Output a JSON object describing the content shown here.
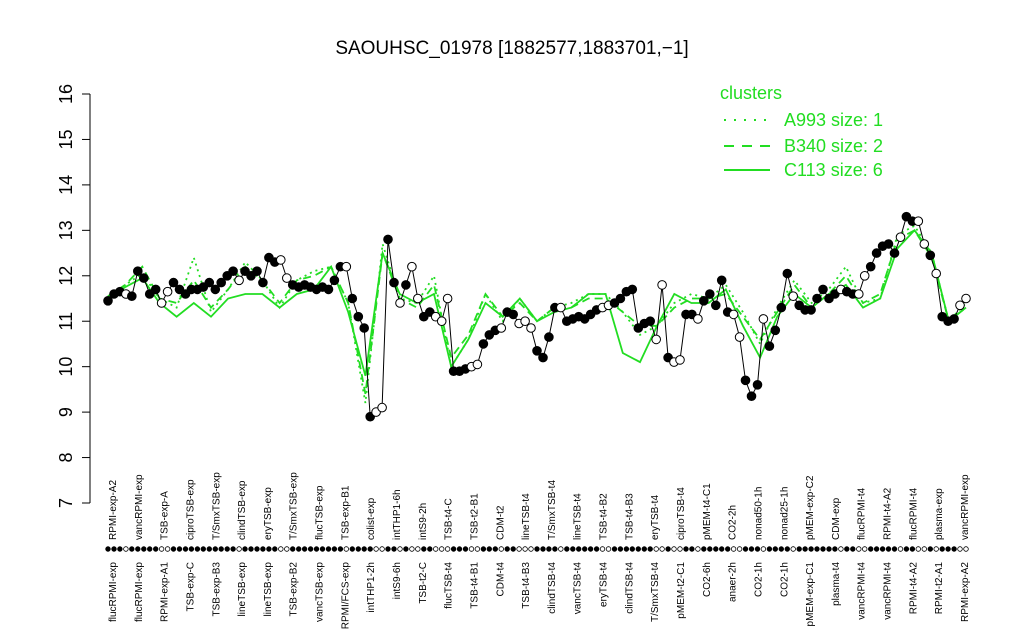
{
  "chart_data": {
    "type": "line",
    "title": "SAOUHSC_01978 [1882577,1883701,−1]",
    "ylim": [
      7,
      16
    ],
    "yticks": [
      7,
      8,
      9,
      10,
      11,
      12,
      13,
      14,
      15,
      16
    ],
    "legend": {
      "title": "clusters",
      "placement": "top-right",
      "entries": [
        {
          "label": "A993 size: 1",
          "style": "dotted"
        },
        {
          "label": "B340 size: 2",
          "style": "dashed"
        },
        {
          "label": "C113 size: 6",
          "style": "solid"
        }
      ]
    },
    "colors": {
      "cluster_line": "#22dd22",
      "points": "#000000",
      "axis": "#000000"
    },
    "top_labels": [
      "RPMI-exp-A2",
      "vancRPMI-exp",
      "TSB-exp-A",
      "ciproTSB-exp",
      "T/SmxTSB-exp",
      "clindTSB-exp",
      "eryTSB-exp",
      "T/SmxTSB-exp",
      "flucTSB-exp",
      "TSB-exp-B1",
      "colist-exp",
      "intTHP1-6h",
      "intS9-2h",
      "TSB-t4-C",
      "TSB-t2-B1",
      "CDM-t2",
      "lineTSB-t4",
      "T/SmxTSB-t4",
      "lineTSB-t4",
      "TSB-t4-B2",
      "TSB-t4-B3",
      "eryTSB-t4",
      "ciproTSB-t4",
      "pMEM-t4-C1",
      "CO2-2h",
      "nonad50-1h",
      "nonad25-1h",
      "pMEM-exp-C2",
      "CDM-exp",
      "flucRPMI-t4",
      "RPMI-t4-A2",
      "flucRPMI-t4",
      "plasma-exp",
      "vancRPMI-exp"
    ],
    "bottom_labels": [
      "flucRPMI-exp",
      "flucRPMI-exp",
      "RPMI-exp-A1",
      "TSB-exp-C",
      "TSB-exp-B3",
      "lineTSB-exp",
      "lineTSB-exp",
      "TSB-exp-B2",
      "vancTSB-exp",
      "RPMI/FCS-exp",
      "intTHP1-2h",
      "intS9-6h",
      "TSB-t2-C",
      "flucTSB-t4",
      "TSB-t4-B1",
      "CDM-t4",
      "TSB-t4-B3",
      "clindTSB-t4",
      "vancTSB-t4",
      "eryTSB-t4",
      "clindTSB-t4",
      "T/SmxTSB-t4",
      "pMEM-t2-C1",
      "CO2-6h",
      "anaer-2h",
      "CO2-1h",
      "CO2-1h",
      "pMEM-exp-C1",
      "plasma-t4",
      "vancRPMI-t4",
      "vancRPMI-t4",
      "RPMI-t4-A2",
      "RPMI-t2-A1",
      "RPMI-exp-A2"
    ],
    "values": [
      11.45,
      11.6,
      11.65,
      11.6,
      11.55,
      12.1,
      11.95,
      11.6,
      11.7,
      11.4,
      11.65,
      11.85,
      11.7,
      11.6,
      11.7,
      11.7,
      11.75,
      11.85,
      11.7,
      11.85,
      12.0,
      12.1,
      11.9,
      12.1,
      12.0,
      12.1,
      11.85,
      12.4,
      12.3,
      12.35,
      11.95,
      11.8,
      11.75,
      11.8,
      11.75,
      11.7,
      11.75,
      11.7,
      11.9,
      12.2,
      12.2,
      11.5,
      11.1,
      10.85,
      8.9,
      9.0,
      9.1,
      12.8,
      11.85,
      11.4,
      11.8,
      12.2,
      11.5,
      11.1,
      11.2,
      11.1,
      11.0,
      11.5,
      9.9,
      9.9,
      9.95,
      10.0,
      10.05,
      10.5,
      10.7,
      10.8,
      10.85,
      11.2,
      11.15,
      10.95,
      11.0,
      10.85,
      10.35,
      10.2,
      10.65,
      11.3,
      11.3,
      11.0,
      11.05,
      11.1,
      11.05,
      11.15,
      11.25,
      11.3,
      11.35,
      11.4,
      11.5,
      11.65,
      11.7,
      10.85,
      10.95,
      11.0,
      10.6,
      11.8,
      10.2,
      10.1,
      10.15,
      11.15,
      11.15,
      11.05,
      11.45,
      11.6,
      11.35,
      11.9,
      11.2,
      11.15,
      10.65,
      9.7,
      9.35,
      9.6,
      11.05,
      10.45,
      10.8,
      11.3,
      12.05,
      11.55,
      11.35,
      11.25,
      11.25,
      11.5,
      11.7,
      11.5,
      11.6,
      11.7,
      11.65,
      11.6,
      11.6,
      12.0,
      12.2,
      12.5,
      12.65,
      12.7,
      12.5,
      12.85,
      13.3,
      13.2,
      13.2,
      12.7,
      12.45,
      12.05,
      11.1,
      11.0,
      11.05,
      11.35,
      11.5
    ],
    "open_points": [
      3,
      9,
      10,
      22,
      29,
      30,
      40,
      45,
      46,
      49,
      51,
      52,
      55,
      56,
      57,
      61,
      62,
      66,
      69,
      70,
      71,
      76,
      83,
      84,
      92,
      93,
      95,
      96,
      99,
      105,
      106,
      110,
      115,
      123,
      126,
      127,
      133,
      136,
      137,
      139,
      143,
      144,
      145,
      148
    ],
    "cluster_lines": {
      "A993": [
        11.55,
        11.8,
        12.05,
        11.5,
        11.3,
        12.4,
        11.2,
        11.7,
        12.3,
        11.9,
        11.3,
        11.9,
        12.1,
        12.2,
        11.4,
        9.2,
        12.7,
        11.5,
        11.4,
        12.0,
        10.0,
        10.6,
        11.6,
        11.0,
        11.5,
        11.0,
        11.3,
        11.4,
        11.6,
        11.6,
        11.2,
        10.7,
        10.9,
        11.4,
        11.6,
        11.5,
        11.8,
        11.2,
        10.5,
        11.3,
        11.9,
        11.4,
        11.7,
        12.2,
        11.4,
        11.5,
        12.9,
        13.1,
        12.5,
        11.0,
        11.4
      ],
      "B340": [
        11.55,
        11.8,
        12.2,
        11.5,
        11.4,
        11.9,
        11.3,
        11.7,
        12.2,
        11.9,
        11.4,
        11.9,
        12.0,
        12.2,
        11.4,
        9.4,
        12.5,
        11.5,
        11.3,
        11.8,
        10.2,
        10.7,
        11.6,
        11.1,
        11.4,
        11.0,
        11.3,
        11.3,
        11.5,
        11.5,
        11.2,
        10.9,
        10.9,
        11.3,
        11.5,
        11.5,
        11.6,
        11.1,
        10.6,
        11.2,
        11.8,
        11.3,
        11.6,
        12.0,
        11.4,
        11.6,
        12.8,
        13.0,
        12.4,
        11.0,
        11.3
      ],
      "C113": [
        11.5,
        11.75,
        11.95,
        11.4,
        11.1,
        11.4,
        11.1,
        11.5,
        11.6,
        11.6,
        11.3,
        11.6,
        11.7,
        12.2,
        11.2,
        9.8,
        12.5,
        11.6,
        11.4,
        11.6,
        10.0,
        10.6,
        11.4,
        11.1,
        11.5,
        11.0,
        11.2,
        11.3,
        11.6,
        11.6,
        10.3,
        10.1,
        10.9,
        11.6,
        11.4,
        11.4,
        11.7,
        10.9,
        10.2,
        11.1,
        11.6,
        11.3,
        11.6,
        11.8,
        11.3,
        11.5,
        12.6,
        13.0,
        12.5,
        11.0,
        11.3
      ]
    }
  }
}
